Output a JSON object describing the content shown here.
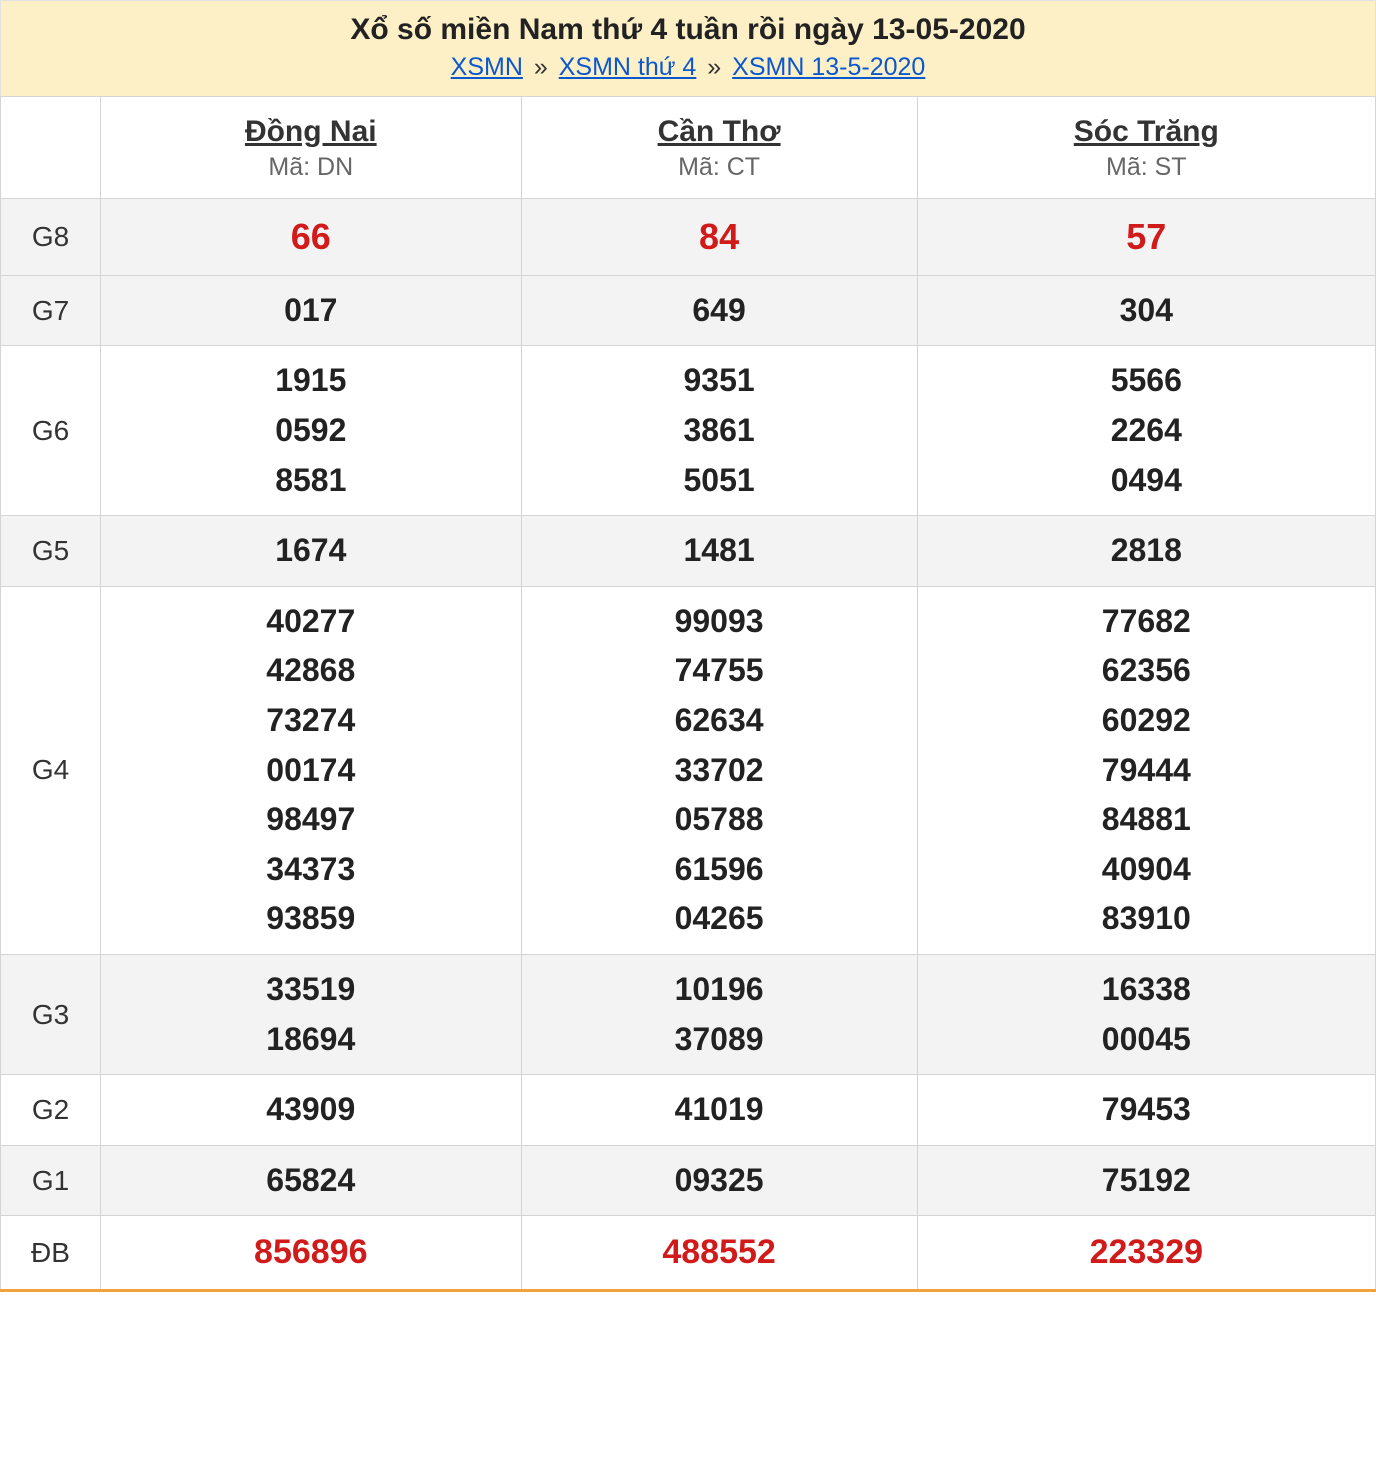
{
  "header": {
    "title": "Xổ số miền Nam thứ 4 tuần rồi ngày 13-05-2020",
    "crumbs": [
      "XSMN",
      "XSMN thứ 4",
      "XSMN 13-5-2020"
    ],
    "sep": "»"
  },
  "code_prefix": "Mã: ",
  "provinces": [
    {
      "name": "Đồng Nai",
      "code": "DN"
    },
    {
      "name": "Cần Thơ",
      "code": "CT"
    },
    {
      "name": "Sóc Trăng",
      "code": "ST"
    }
  ],
  "rows": [
    {
      "label": "G8",
      "shade": true,
      "style": "g8",
      "cells": [
        [
          "66"
        ],
        [
          "84"
        ],
        [
          "57"
        ]
      ]
    },
    {
      "label": "G7",
      "shade": true,
      "style": "normal",
      "cells": [
        [
          "017"
        ],
        [
          "649"
        ],
        [
          "304"
        ]
      ]
    },
    {
      "label": "G6",
      "shade": false,
      "style": "normal",
      "cells": [
        [
          "1915",
          "0592",
          "8581"
        ],
        [
          "9351",
          "3861",
          "5051"
        ],
        [
          "5566",
          "2264",
          "0494"
        ]
      ]
    },
    {
      "label": "G5",
      "shade": true,
      "style": "normal",
      "cells": [
        [
          "1674"
        ],
        [
          "1481"
        ],
        [
          "2818"
        ]
      ]
    },
    {
      "label": "G4",
      "shade": false,
      "style": "normal",
      "cells": [
        [
          "40277",
          "42868",
          "73274",
          "00174",
          "98497",
          "34373",
          "93859"
        ],
        [
          "99093",
          "74755",
          "62634",
          "33702",
          "05788",
          "61596",
          "04265"
        ],
        [
          "77682",
          "62356",
          "60292",
          "79444",
          "84881",
          "40904",
          "83910"
        ]
      ]
    },
    {
      "label": "G3",
      "shade": true,
      "style": "normal",
      "cells": [
        [
          "33519",
          "18694"
        ],
        [
          "10196",
          "37089"
        ],
        [
          "16338",
          "00045"
        ]
      ]
    },
    {
      "label": "G2",
      "shade": false,
      "style": "normal",
      "cells": [
        [
          "43909"
        ],
        [
          "41019"
        ],
        [
          "79453"
        ]
      ]
    },
    {
      "label": "G1",
      "shade": true,
      "style": "normal",
      "cells": [
        [
          "65824"
        ],
        [
          "09325"
        ],
        [
          "75192"
        ]
      ]
    },
    {
      "label": "ĐB",
      "shade": false,
      "style": "special",
      "cells": [
        [
          "856896"
        ],
        [
          "488552"
        ],
        [
          "223329"
        ]
      ]
    }
  ]
}
